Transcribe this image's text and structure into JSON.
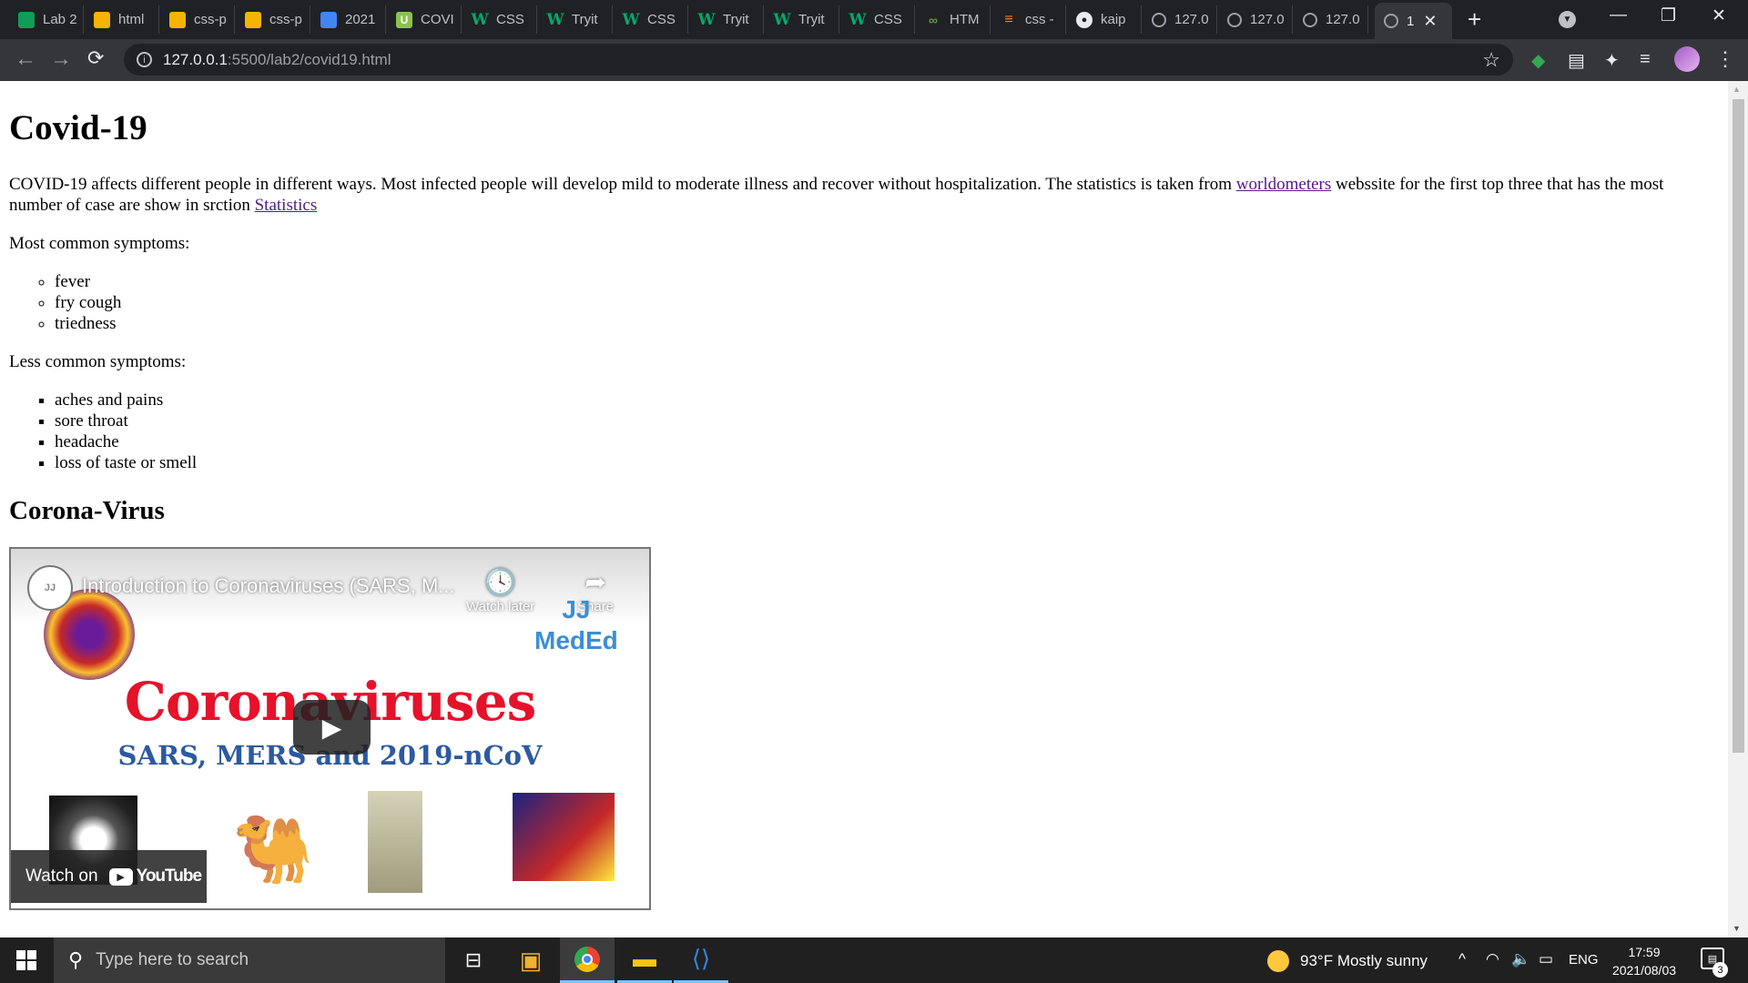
{
  "browser": {
    "tabs": [
      {
        "title": "Lab 2",
        "icon": "sheets-icon",
        "favicon_text": ""
      },
      {
        "title": "html",
        "icon": "slides-icon",
        "favicon_text": ""
      },
      {
        "title": "css-p",
        "icon": "slides-icon",
        "favicon_text": ""
      },
      {
        "title": "css-p",
        "icon": "slides-icon",
        "favicon_text": ""
      },
      {
        "title": "2021",
        "icon": "docs-icon",
        "favicon_text": ""
      },
      {
        "title": "COVI",
        "icon": "upwork-icon",
        "favicon_text": "U"
      },
      {
        "title": "CSS",
        "icon": "w3schools-icon",
        "favicon_text": "W"
      },
      {
        "title": "Tryit",
        "icon": "w3schools-icon",
        "favicon_text": "W"
      },
      {
        "title": "CSS",
        "icon": "w3schools-icon",
        "favicon_text": "W"
      },
      {
        "title": "Tryit",
        "icon": "w3schools-icon",
        "favicon_text": "W"
      },
      {
        "title": "Tryit",
        "icon": "w3schools-icon",
        "favicon_text": "W"
      },
      {
        "title": "CSS",
        "icon": "w3schools-icon",
        "favicon_text": "W"
      },
      {
        "title": "HTM",
        "icon": "codepen-icon",
        "favicon_text": "∞"
      },
      {
        "title": "css -",
        "icon": "stackoverflow-icon",
        "favicon_text": "≡"
      },
      {
        "title": "kaip",
        "icon": "github-icon",
        "favicon_text": "●"
      },
      {
        "title": "127.0",
        "icon": "globe-icon",
        "favicon_text": ""
      },
      {
        "title": "127.0",
        "icon": "globe-icon",
        "favicon_text": ""
      },
      {
        "title": "127.0",
        "icon": "globe-icon",
        "favicon_text": ""
      },
      {
        "title": "1",
        "icon": "globe-icon",
        "favicon_text": "",
        "active": true
      }
    ],
    "close_glyph": "✕",
    "new_tab_glyph": "+",
    "window_controls": {
      "minimize": "—",
      "maximize": "❐",
      "close": "✕"
    },
    "nav": {
      "back": "←",
      "forward": "→",
      "reload": "⟳"
    },
    "url_host": "127.0.0.1",
    "url_path": ":5500/lab2/covid19.html",
    "star_glyph": "☆",
    "menu_glyph": "⋮",
    "info_glyph": "i"
  },
  "page": {
    "heading": "Covid-19",
    "intro_text": "COVID-19 affects different people in different ways. Most infected people will develop mild to moderate illness and recover without hospitalization. The statistics is taken from ",
    "intro_link": "worldometers",
    "intro_text2": " webssite for the first top three that has the most number of case are show in srction ",
    "intro_link2": "Statistics",
    "common_label": "Most common symptoms:",
    "common_symptoms": [
      "fever",
      "fry cough",
      "triedness"
    ],
    "less_common_label": "Less common symptoms:",
    "less_common_symptoms": [
      "aches and pains",
      "sore throat",
      "headache",
      "loss of taste or smell"
    ],
    "subheading": "Corona-Virus"
  },
  "video": {
    "title": "Introduction to Coronaviruses (SARS, M...",
    "watch_later": "Watch later",
    "share": "Share",
    "channel_logo_text": "JJ",
    "brand_line1": "JJ",
    "brand_line2": "MedEd",
    "headline": "Coronaviruses",
    "subline": "SARS, MERS and 2019-nCoV",
    "watch_on": "Watch on",
    "youtube": "YouTube",
    "play_glyph": "▶",
    "clock_glyph": "🕓",
    "share_glyph": "➦",
    "camel_glyph": "🐫"
  },
  "taskbar": {
    "search_placeholder": "Type here to search",
    "search_glyph": "⚲",
    "weather": "93°F  Mostly sunny",
    "tray_up": "^",
    "lang": "ENG",
    "time": "17:59",
    "date": "2021/08/03",
    "notifications": "3"
  },
  "colors": {
    "link_visited": "#551a8b",
    "tab_bar": "#202124",
    "toolbar": "#35363a",
    "taskbar": "#202020",
    "headline_red": "#e5122a",
    "subline_blue": "#2c5aa0"
  }
}
